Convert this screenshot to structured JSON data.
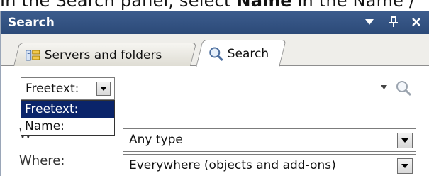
{
  "instruction": {
    "prefix": "In the Search panel, select ",
    "bold": "Name",
    "suffix": " in the Name /"
  },
  "panel": {
    "title": "Search",
    "controls": {
      "menu_glyph": "▾",
      "pin_glyph": "ᵖ",
      "close_glyph": "×"
    }
  },
  "tabs": [
    {
      "label": "Servers and folders",
      "icon": "servers-folders-icon",
      "active": false
    },
    {
      "label": "Search",
      "icon": "magnifier-icon",
      "active": true
    }
  ],
  "search_mode": {
    "selected": "Freetext:",
    "options": [
      "Freetext:",
      "Name:"
    ],
    "highlighted": "Freetext:"
  },
  "search_field": {
    "value": ""
  },
  "type_filter": {
    "value": "Any type"
  },
  "where_filter": {
    "label": "Where:",
    "value": "Everywhere (objects and add-ons)"
  },
  "colors": {
    "titlebar": "#2c4a78",
    "highlight": "#0a246a"
  }
}
